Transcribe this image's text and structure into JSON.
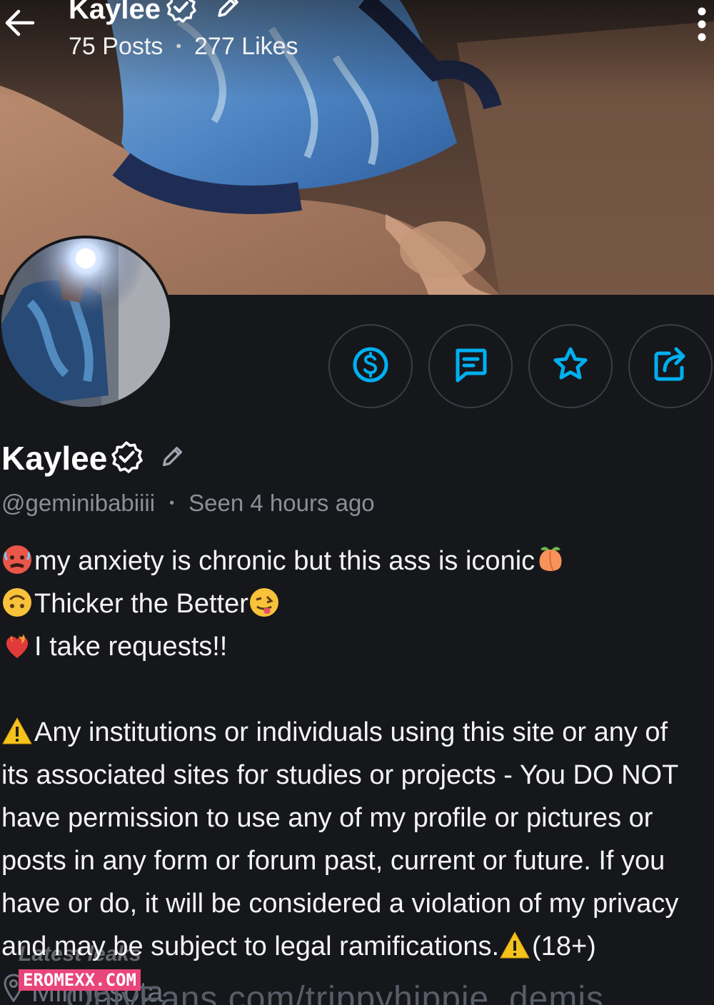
{
  "header": {
    "title": "Kaylee",
    "posts": "75 Posts",
    "likes": "277 Likes",
    "separator": "•"
  },
  "icons": {
    "back": "arrow-left-icon",
    "verified": "verified-badge-icon",
    "edit": "pencil-icon",
    "more": "more-vertical-icon",
    "tip": "dollar-icon",
    "message": "message-icon",
    "favorite": "star-icon",
    "share": "share-icon",
    "location": "location-pin-icon"
  },
  "colors": {
    "accent": "#00aff0",
    "background": "#16171b",
    "muted": "#8a8f99",
    "button_border": "#3a3d44"
  },
  "profile": {
    "name": "Kaylee",
    "handle": "@geminibabiiii",
    "separator": "•",
    "last_seen": "Seen 4 hours ago"
  },
  "bio": {
    "line1": "my anxiety is chronic but this ass is iconic",
    "line2": "Thicker the Better",
    "line3": "I take requests!!",
    "notice": [
      "Any institutions or individuals using this site or any of",
      "its associated sites for studies or projects - You DO NOT",
      "have permission to use any of my profile or pictures or",
      "posts in any form or forum past, current or future. If you",
      "have or do, it will be considered a violation of my privacy",
      "and may be subject to legal ramifications."
    ],
    "age_tag": "(18+)"
  },
  "location": {
    "text": "Minnesota",
    "link": "OnlyFans.com/trippyhippie_demis"
  },
  "watermark": {
    "top": "Latest leaks",
    "badge": "EROMEXX.COM"
  }
}
